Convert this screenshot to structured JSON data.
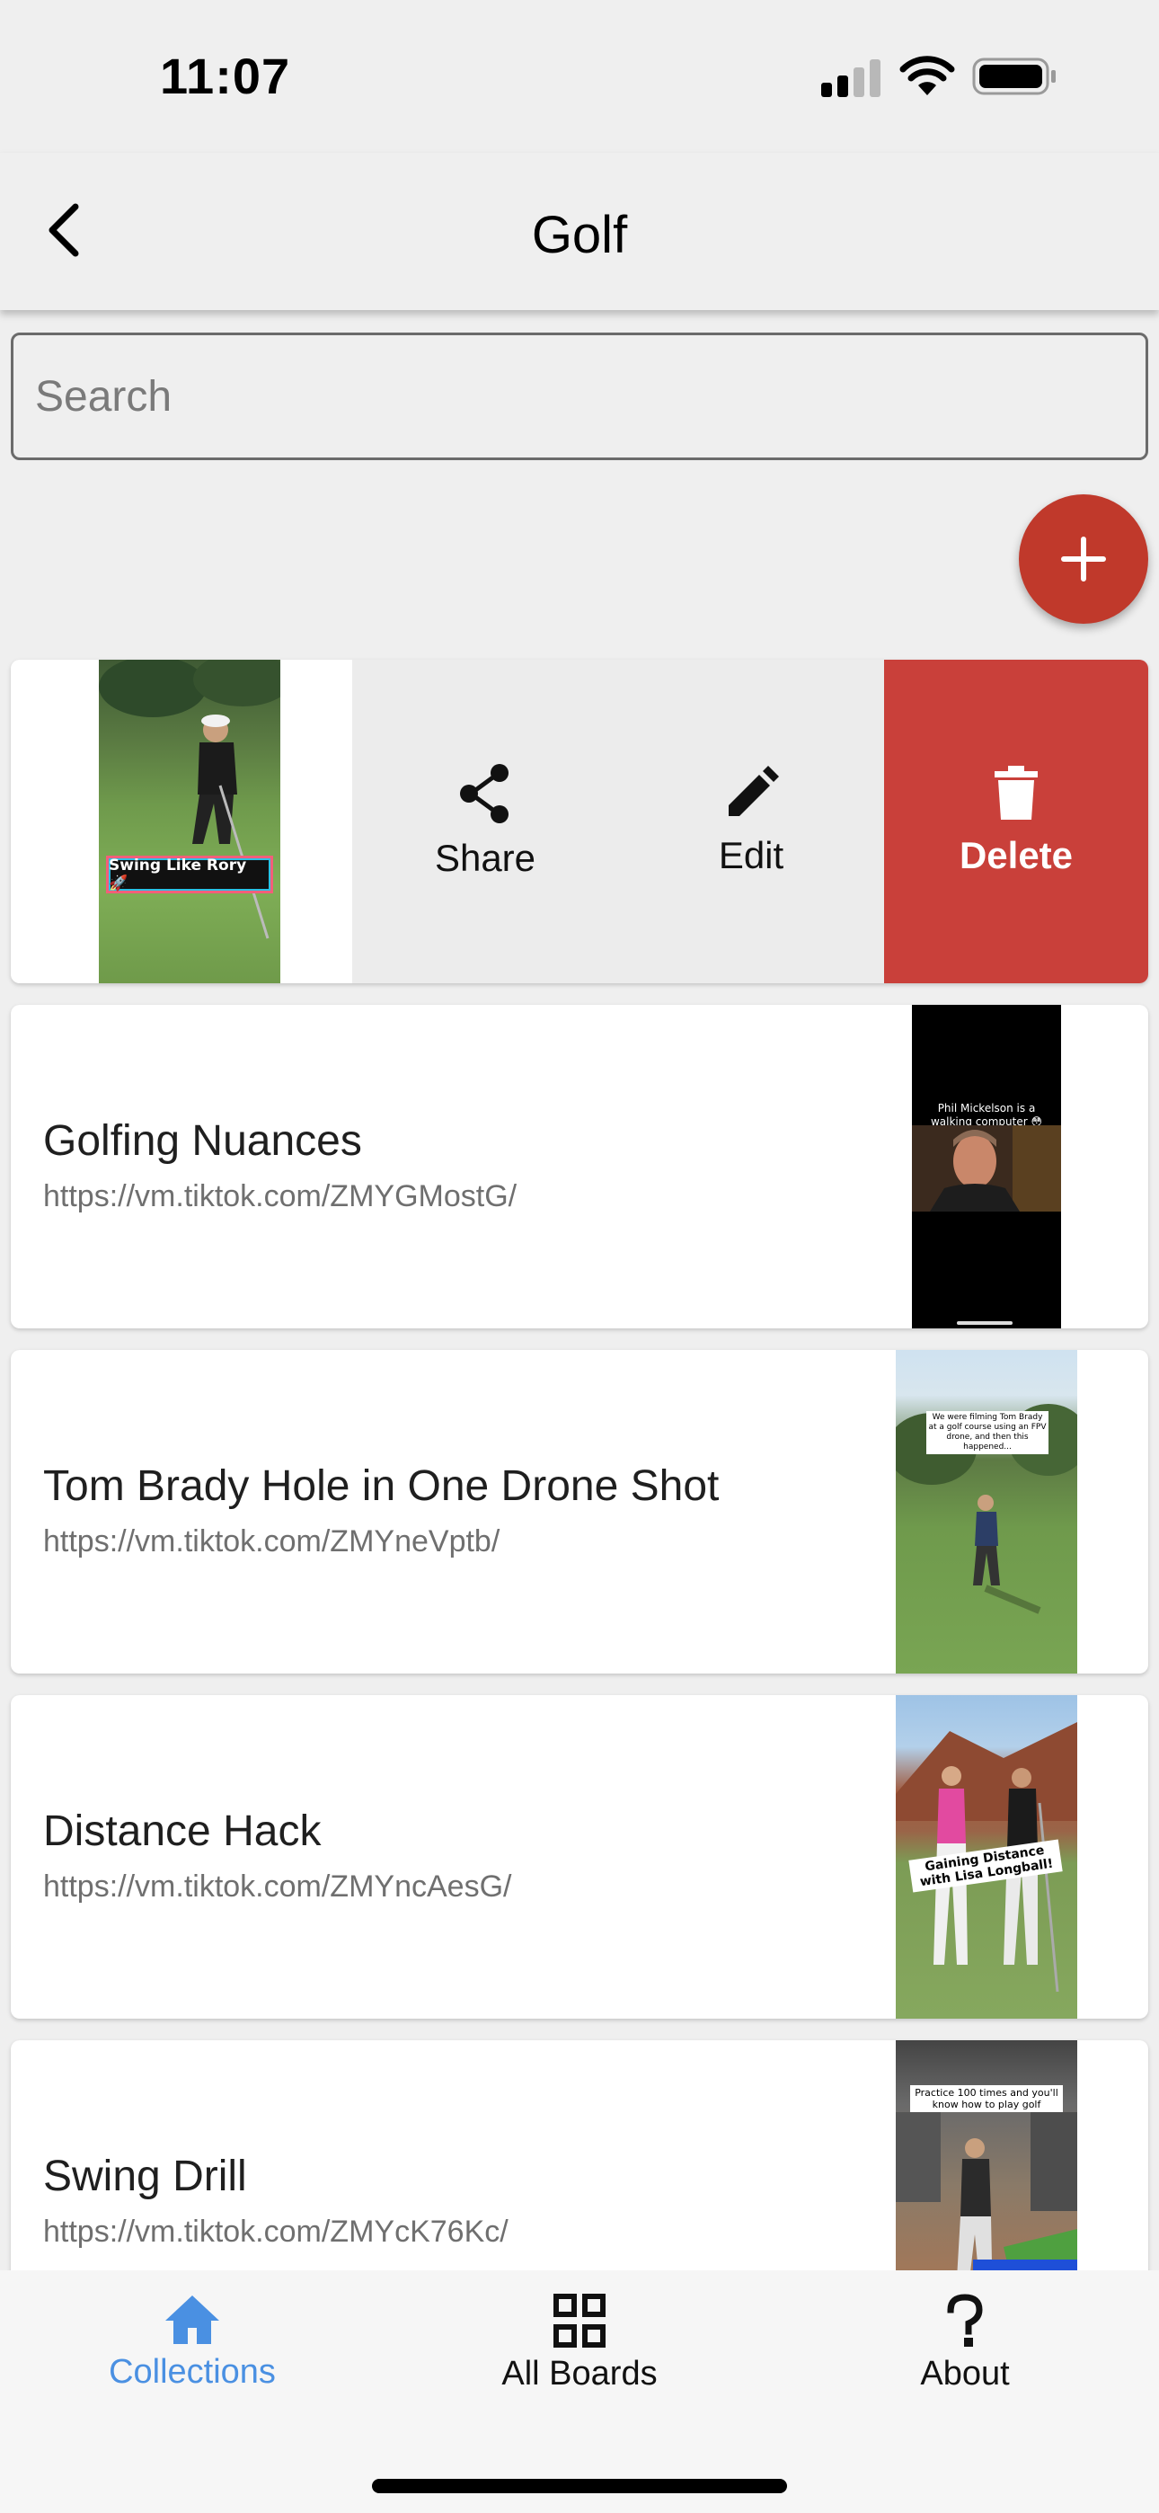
{
  "status_bar": {
    "time": "11:07"
  },
  "header": {
    "title": "Golf"
  },
  "search": {
    "placeholder": "Search",
    "value": ""
  },
  "swiped_item": {
    "thumbnail_caption": "Swing Like Rory 🚀",
    "actions": {
      "share": "Share",
      "edit": "Edit",
      "delete": "Delete"
    }
  },
  "items": [
    {
      "title": "Golfing Nuances",
      "url": "https://vm.tiktok.com/ZMYGMostG/",
      "thumbnail_caption": "Phil Mickelson is a walking computer 😳"
    },
    {
      "title": "Tom Brady Hole in One Drone Shot",
      "url": "https://vm.tiktok.com/ZMYneVptb/",
      "thumbnail_caption": "We were filming Tom Brady at a golf course using an FPV drone, and then this happened..."
    },
    {
      "title": "Distance Hack",
      "url": "https://vm.tiktok.com/ZMYncAesG/",
      "thumbnail_caption": "Gaining Distance with Lisa Longball!"
    },
    {
      "title": "Swing Drill",
      "url": "https://vm.tiktok.com/ZMYcK76Kc/",
      "thumbnail_caption": "Practice 100 times and you'll know how to play golf"
    }
  ],
  "bottom_nav": {
    "items": [
      {
        "label": "Collections",
        "icon": "home-icon",
        "active": true
      },
      {
        "label": "All Boards",
        "icon": "grid-icon",
        "active": false
      },
      {
        "label": "About",
        "icon": "question-icon",
        "active": false
      }
    ]
  },
  "colors": {
    "accent": "#4a90e2",
    "fab": "#c0392b",
    "delete": "#c9403a",
    "background": "#efefef"
  }
}
